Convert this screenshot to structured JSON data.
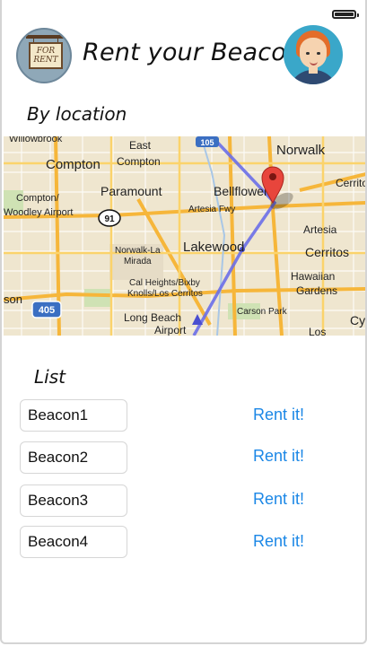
{
  "header": {
    "title": "Rent your Beacon",
    "logo_text": "FOR RENT"
  },
  "location": {
    "label": "By location",
    "map": {
      "places": [
        {
          "name": "Willowbrook"
        },
        {
          "name": "East"
        },
        {
          "name": "Compton"
        },
        {
          "name": "Compton"
        },
        {
          "name": "Norwalk"
        },
        {
          "name": "Compton/"
        },
        {
          "name": "Woodley Airport"
        },
        {
          "name": "Paramount"
        },
        {
          "name": "Bellflower"
        },
        {
          "name": "Cerritos"
        },
        {
          "name": "Artesia Fwy"
        },
        {
          "name": "Artesia"
        },
        {
          "name": "Norwalk-La"
        },
        {
          "name": "Mirada"
        },
        {
          "name": "Lakewood"
        },
        {
          "name": "Cerritos"
        },
        {
          "name": "Hawaiian"
        },
        {
          "name": "Gardens"
        },
        {
          "name": "Cal Heights/Bixby"
        },
        {
          "name": "Knolls/Los Cerritos"
        },
        {
          "name": "son"
        },
        {
          "name": "Carson Park"
        },
        {
          "name": "Long Beach"
        },
        {
          "name": "Airport"
        },
        {
          "name": "Los"
        },
        {
          "name": "Cy"
        }
      ],
      "shields": [
        "105",
        "91",
        "405"
      ]
    }
  },
  "list": {
    "label": "List",
    "items": [
      {
        "name": "Beacon1",
        "action": "Rent it!"
      },
      {
        "name": "Beacon2",
        "action": "Rent it!"
      },
      {
        "name": "Beacon3",
        "action": "Rent it!"
      },
      {
        "name": "Beacon4",
        "action": "Rent it!"
      }
    ]
  },
  "status": {
    "battery_level": 1.0
  },
  "colors": {
    "accent": "#1b87e6",
    "route": "#6a6ee8",
    "pin": "#e8453c",
    "avatar_bg": "#3aa7c9"
  }
}
